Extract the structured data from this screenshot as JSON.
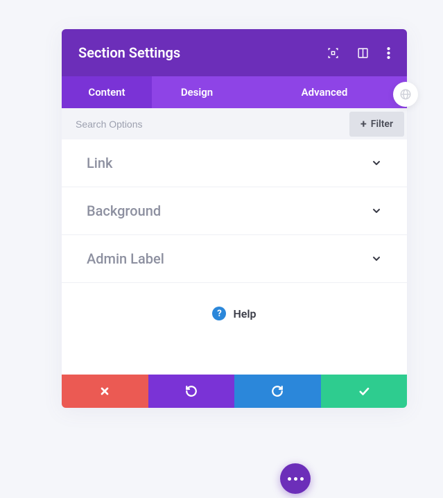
{
  "header": {
    "title": "Section Settings"
  },
  "tabs": {
    "content": "Content",
    "design": "Design",
    "advanced": "Advanced"
  },
  "filter": {
    "search_placeholder": "Search Options",
    "button_label": "Filter"
  },
  "options": [
    {
      "label": "Link"
    },
    {
      "label": "Background"
    },
    {
      "label": "Admin Label"
    }
  ],
  "help": {
    "label": "Help"
  }
}
